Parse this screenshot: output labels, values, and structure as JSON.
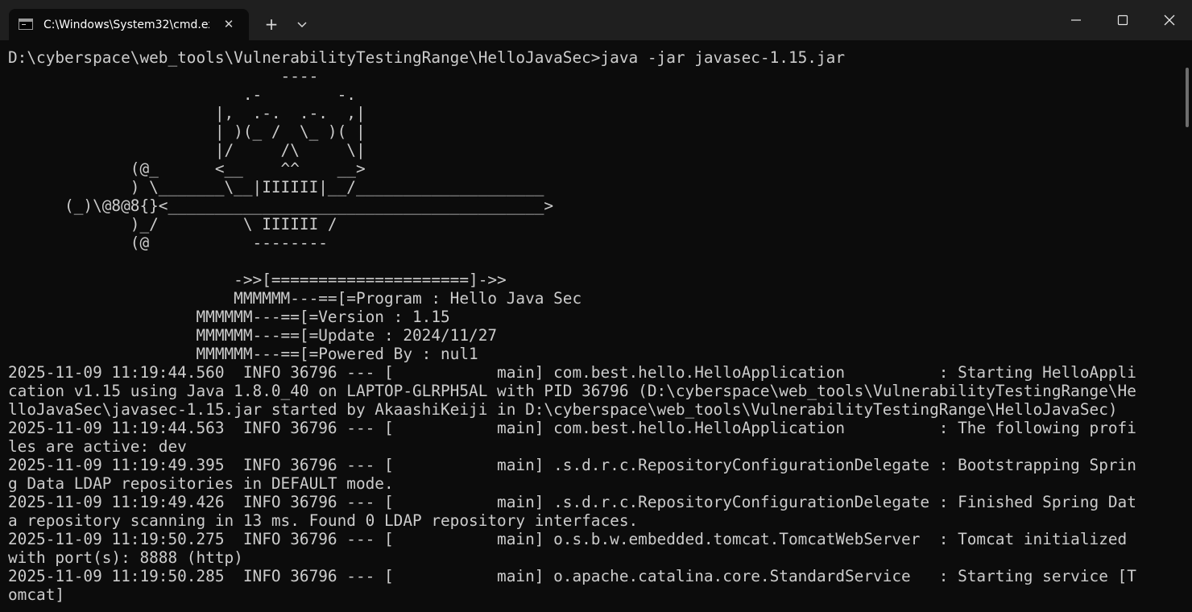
{
  "window": {
    "tab_title": "C:\\Windows\\System32\\cmd.exe",
    "tab_close_glyph": "✕",
    "new_tab_glyph": "+"
  },
  "terminal": {
    "lines": [
      "D:\\cyberspace\\web_tools\\VulnerabilityTestingRange\\HelloJavaSec>java -jar javasec-1.15.jar",
      "                             ----",
      "                         .-        -.",
      "                      |,  .-.  .-.  ,|",
      "                      | )(_ /  \\_ )( |",
      "                      |/     /\\     \\|",
      "             (@_      <__    ^^    __>",
      "             ) \\_______\\__|IIIIII|__/____________________",
      "      (_)\\@8@8{}<________________________________________>",
      "             )_/         \\ IIIIII /",
      "             (@           --------",
      "",
      "                        ->>[=====================]->>",
      "                        MMMMMM---==[=Program : Hello Java Sec",
      "                    MMMMMM---==[=Version : 1.15",
      "                    MMMMMM---==[=Update : 2024/11/27",
      "                    MMMMMM---==[=Powered By : nul1",
      "2025-11-09 11:19:44.560  INFO 36796 --- [           main] com.best.hello.HelloApplication          : Starting HelloAppli",
      "cation v1.15 using Java 1.8.0_40 on LAPTOP-GLRPH5AL with PID 36796 (D:\\cyberspace\\web_tools\\VulnerabilityTestingRange\\He",
      "lloJavaSec\\javasec-1.15.jar started by AkaashiKeiji in D:\\cyberspace\\web_tools\\VulnerabilityTestingRange\\HelloJavaSec)",
      "2025-11-09 11:19:44.563  INFO 36796 --- [           main] com.best.hello.HelloApplication          : The following profi",
      "les are active: dev",
      "2025-11-09 11:19:49.395  INFO 36796 --- [           main] .s.d.r.c.RepositoryConfigurationDelegate : Bootstrapping Sprin",
      "g Data LDAP repositories in DEFAULT mode.",
      "2025-11-09 11:19:49.426  INFO 36796 --- [           main] .s.d.r.c.RepositoryConfigurationDelegate : Finished Spring Dat",
      "a repository scanning in 13 ms. Found 0 LDAP repository interfaces.",
      "2025-11-09 11:19:50.275  INFO 36796 --- [           main] o.s.b.w.embedded.tomcat.TomcatWebServer  : Tomcat initialized",
      "with port(s): 8888 (http)",
      "2025-11-09 11:19:50.285  INFO 36796 --- [           main] o.apache.catalina.core.StandardService   : Starting service [T",
      "omcat]"
    ]
  },
  "colors": {
    "background": "#0c0c0c",
    "foreground": "#cccccc",
    "titlebar": "#1f1f1f"
  }
}
